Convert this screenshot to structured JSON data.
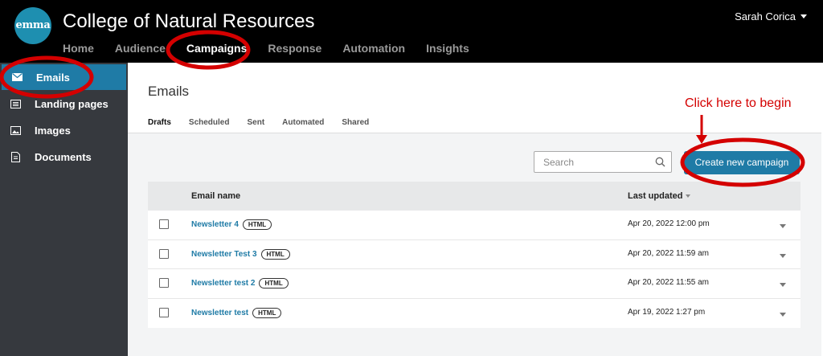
{
  "app": {
    "logo_text": "emma",
    "title": "College of Natural Resources",
    "user_name": "Sarah Corica"
  },
  "topnav": {
    "items": [
      {
        "label": "Home"
      },
      {
        "label": "Audience"
      },
      {
        "label": "Campaigns",
        "active": true
      },
      {
        "label": "Response"
      },
      {
        "label": "Automation"
      },
      {
        "label": "Insights"
      }
    ]
  },
  "sidebar": {
    "items": [
      {
        "label": "Emails",
        "icon": "envelope-icon",
        "active": true
      },
      {
        "label": "Landing pages",
        "icon": "page-icon"
      },
      {
        "label": "Images",
        "icon": "image-icon"
      },
      {
        "label": "Documents",
        "icon": "document-icon"
      }
    ]
  },
  "main": {
    "title": "Emails",
    "tabs": [
      {
        "label": "Drafts",
        "active": true
      },
      {
        "label": "Scheduled"
      },
      {
        "label": "Sent"
      },
      {
        "label": "Automated"
      },
      {
        "label": "Shared"
      }
    ],
    "search": {
      "placeholder": "Search",
      "value": ""
    },
    "create_button_label": "Create new campaign",
    "table": {
      "columns": [
        "Email name",
        "Last updated"
      ],
      "rows": [
        {
          "name": "Newsletter 4",
          "badge": "HTML",
          "updated": "Apr 20, 2022 12:00 pm"
        },
        {
          "name": "Newsletter Test 3",
          "badge": "HTML",
          "updated": "Apr 20, 2022 11:59 am"
        },
        {
          "name": "Newsletter test 2",
          "badge": "HTML",
          "updated": "Apr 20, 2022 11:55 am"
        },
        {
          "name": "Newsletter test",
          "badge": "HTML",
          "updated": "Apr 19, 2022 1:27 pm"
        }
      ]
    }
  },
  "annotation": {
    "text": "Click here to begin",
    "color": "#d40000"
  },
  "colors": {
    "accent": "#1f7ba6",
    "header_bg": "#000000",
    "sidebar_bg": "#36393e",
    "logo_bg": "#1e8fb0"
  }
}
